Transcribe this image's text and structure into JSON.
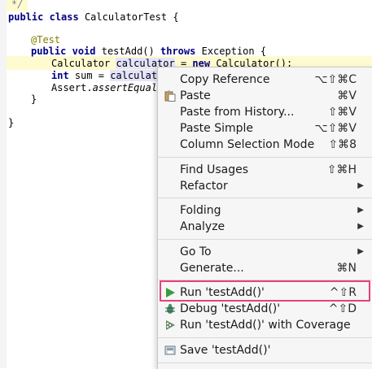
{
  "editor": {
    "comment_close": "*/",
    "class_decl": {
      "kw1": "public",
      "kw2": "class",
      "name": "CalculatorTest {"
    },
    "annotation": "@Test",
    "method_decl": {
      "kw1": "public",
      "kw2": "void",
      "name": "testAdd()",
      "kw3": "throws",
      "rest": "Exception {"
    },
    "line_calc": {
      "type": "Calculator ",
      "var": "calculator",
      "mid": " = ",
      "kw": "new",
      "rest": " Calculator();"
    },
    "line_sum": {
      "kw": "int",
      "mid": " sum = ",
      "var": "calculator"
    },
    "line_assert": {
      "cls": "Assert.",
      "method": "assertEquals("
    },
    "close_method": "}",
    "close_class": "}"
  },
  "menu": {
    "items": [
      {
        "label": "Copy Reference",
        "shortcut": "⌥⇧⌘C"
      },
      {
        "label": "Paste",
        "shortcut": "⌘V",
        "icon": "paste-icon"
      },
      {
        "label": "Paste from History...",
        "shortcut": "⇧⌘V"
      },
      {
        "label": "Paste Simple",
        "shortcut": "⌥⇧⌘V"
      },
      {
        "label": "Column Selection Mode",
        "shortcut": "⇧⌘8"
      },
      {
        "label": "Find Usages",
        "shortcut": "⇧⌘H"
      },
      {
        "label": "Refactor",
        "submenu": true
      },
      {
        "label": "Folding",
        "submenu": true
      },
      {
        "label": "Analyze",
        "submenu": true
      },
      {
        "label": "Go To",
        "submenu": true
      },
      {
        "label": "Generate...",
        "shortcut": "⌘N"
      },
      {
        "label": "Run 'testAdd()'",
        "shortcut": "^⇧R",
        "icon": "run-icon",
        "highlighted_outline": "#e7417a"
      },
      {
        "label": "Debug 'testAdd()'",
        "shortcut": "^⇧D",
        "icon": "debug-icon"
      },
      {
        "label": "Run 'testAdd()' with Coverage",
        "icon": "coverage-icon"
      },
      {
        "label": "Save 'testAdd()'",
        "icon": "save-icon"
      }
    ],
    "submenu_arrow": "▶"
  },
  "colors": {
    "keyword": "#000080",
    "annotation": "#808000",
    "run_green": "#3a9c3a",
    "highlight_outline": "#e7417a"
  }
}
